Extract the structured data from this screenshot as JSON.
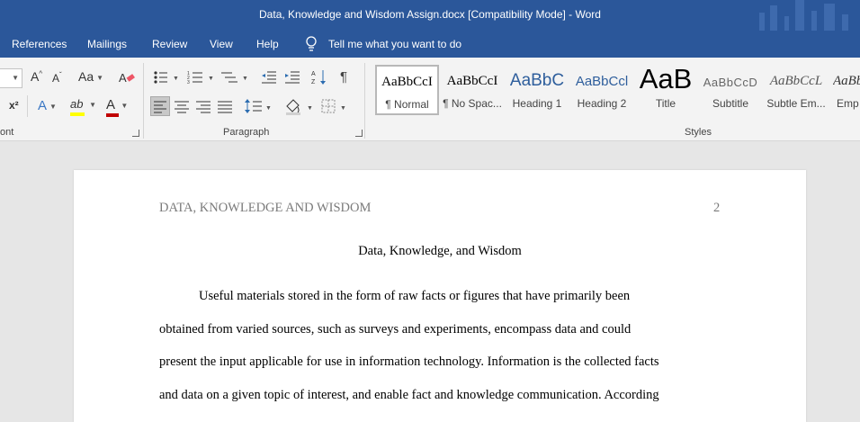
{
  "window": {
    "title": "Data, Knowledge and Wisdom Assign.docx [Compatibility Mode]  -  Word"
  },
  "menu": {
    "items": [
      "References",
      "Mailings",
      "Review",
      "View",
      "Help"
    ],
    "tell_me": "Tell me what you want to do"
  },
  "ribbon": {
    "font_group_label": "ont",
    "paragraph_group_label": "Paragraph",
    "styles_group_label": "Styles",
    "superscript_label": "x²",
    "grow_font_label": "A",
    "shrink_font_label": "A",
    "change_case_label": "Aa",
    "text_effects_label": "A",
    "font_color_label": "A",
    "highlight_label": "ab",
    "styles": [
      {
        "sample": "AaBbCcI",
        "name": "¶ Normal"
      },
      {
        "sample": "AaBbCcI",
        "name": "¶ No Spac..."
      },
      {
        "sample": "AaBbC",
        "name": "Heading 1"
      },
      {
        "sample": "AaBbCcl",
        "name": "Heading 2"
      },
      {
        "sample": "AaB",
        "name": "Title"
      },
      {
        "sample": "AaBbCcD",
        "name": "Subtitle"
      },
      {
        "sample": "AaBbCcL",
        "name": "Subtle Em..."
      },
      {
        "sample": "AaBbi",
        "name": "Emp"
      }
    ]
  },
  "document": {
    "header_left": "DATA, KNOWLEDGE AND WISDOM",
    "page_number": "2",
    "title": "Data, Knowledge, and Wisdom",
    "lines": [
      "Useful materials stored in the form of raw facts or figures that have primarily been",
      "obtained from varied sources, such as surveys and experiments, encompass data and could",
      "present the input applicable for use in information technology. Information is the collected facts",
      "and data on a given topic of interest, and enable fact and knowledge communication. According"
    ]
  },
  "colors": {
    "titlebar": "#2b579a",
    "ribbon": "#f3f3f3",
    "workspace": "#e6e6e6",
    "font_color_red": "#c00000",
    "highlight_yellow": "#ffff00"
  }
}
